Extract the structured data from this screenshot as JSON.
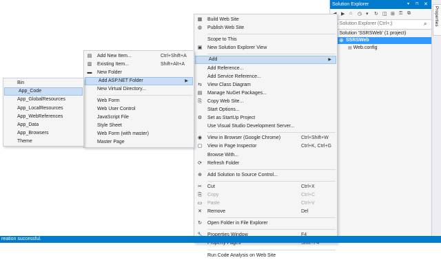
{
  "solution_explorer": {
    "title": "Solution Explorer",
    "search_placeholder": "rch Solution Explorer (Ctrl+;)",
    "tree": {
      "solution": "Solution 'SSRSWeb' (1 project)",
      "project": "SSRSWeb",
      "file": "Web.config"
    },
    "tool_glyphs": [
      "◀",
      "▶",
      "⌂",
      "◷",
      "▾",
      "↻",
      "◫",
      "⊞",
      "⚿",
      "⧉"
    ]
  },
  "properties_tab": "Properties",
  "status_bar": {
    "text": "reation successful."
  },
  "context_menu": {
    "items": [
      {
        "icon": "▦",
        "label": "Build Web Site"
      },
      {
        "icon": "◍",
        "label": "Publish Web Site"
      },
      {
        "sep": true
      },
      {
        "icon": "",
        "label": "Scope to This"
      },
      {
        "icon": "▣",
        "label": "New Solution Explorer View"
      },
      {
        "sep": true
      },
      {
        "icon": "",
        "label": "Add",
        "arrow": "▶",
        "hl": true
      },
      {
        "icon": "",
        "label": "Add Reference..."
      },
      {
        "icon": "",
        "label": "Add Service Reference..."
      },
      {
        "icon": "⇆",
        "label": "View Class Diagram"
      },
      {
        "icon": "▤",
        "label": "Manage NuGet Packages..."
      },
      {
        "icon": "⎘",
        "label": "Copy Web Site..."
      },
      {
        "icon": "",
        "label": "Start Options..."
      },
      {
        "icon": "⚙",
        "label": "Set as StartUp Project"
      },
      {
        "icon": "",
        "label": "Use Visual Studio Development Server..."
      },
      {
        "sep": true
      },
      {
        "icon": "◉",
        "label": "View in Browser (Google Chrome)",
        "shortcut": "Ctrl+Shift+W"
      },
      {
        "icon": "▢",
        "label": "View in Page Inspector",
        "shortcut": "Ctrl+K, Ctrl+G"
      },
      {
        "icon": "",
        "label": "Browse With..."
      },
      {
        "icon": "⟳",
        "label": "Refresh Folder"
      },
      {
        "sep": true
      },
      {
        "icon": "⊕",
        "label": "Add Solution to Source Control..."
      },
      {
        "sep": true
      },
      {
        "icon": "✂",
        "label": "Cut",
        "shortcut": "Ctrl+X"
      },
      {
        "icon": "⎘",
        "label": "Copy",
        "shortcut": "Ctrl+C",
        "disabled": true
      },
      {
        "icon": "▭",
        "label": "Paste",
        "shortcut": "Ctrl+V",
        "disabled": true
      },
      {
        "icon": "✕",
        "label": "Remove",
        "shortcut": "Del"
      },
      {
        "sep": true
      },
      {
        "icon": "↻",
        "label": "Open Folder in File Explorer"
      },
      {
        "sep": true
      },
      {
        "icon": "🔧",
        "label": "Properties Window",
        "shortcut": "F4"
      },
      {
        "icon": "",
        "label": "Property Pages",
        "shortcut": "Shift+F4"
      },
      {
        "sep": true
      },
      {
        "icon": "",
        "label": "Run Code Analysis on Web Site"
      }
    ]
  },
  "add_submenu": {
    "items": [
      {
        "icon": "▤",
        "label": "Add New Item...",
        "shortcut": "Ctrl+Shift+A"
      },
      {
        "icon": "▥",
        "label": "Existing Item...",
        "shortcut": "Shift+Alt+A"
      },
      {
        "icon": "▬",
        "label": "New Folder"
      },
      {
        "icon": "",
        "label": "Add ASP.NET Folder",
        "arrow": "▶",
        "hl": true
      },
      {
        "icon": "",
        "label": "New Virtual Directory..."
      },
      {
        "sep": true
      },
      {
        "icon": "",
        "label": "Web Form"
      },
      {
        "icon": "",
        "label": "Web User Control"
      },
      {
        "icon": "",
        "label": "JavaScript File"
      },
      {
        "icon": "",
        "label": "Style Sheet"
      },
      {
        "icon": "",
        "label": "Web Form (with master)"
      },
      {
        "icon": "",
        "label": "Master Page"
      }
    ]
  },
  "aspnet_submenu": {
    "items": [
      {
        "label": "Bin"
      },
      {
        "label": "App_Code",
        "hl": true
      },
      {
        "label": "App_GlobalResources"
      },
      {
        "label": "App_LocalResources"
      },
      {
        "label": "App_WebReferences"
      },
      {
        "label": "App_Data"
      },
      {
        "label": "App_Browsers"
      },
      {
        "label": "Theme"
      }
    ]
  }
}
